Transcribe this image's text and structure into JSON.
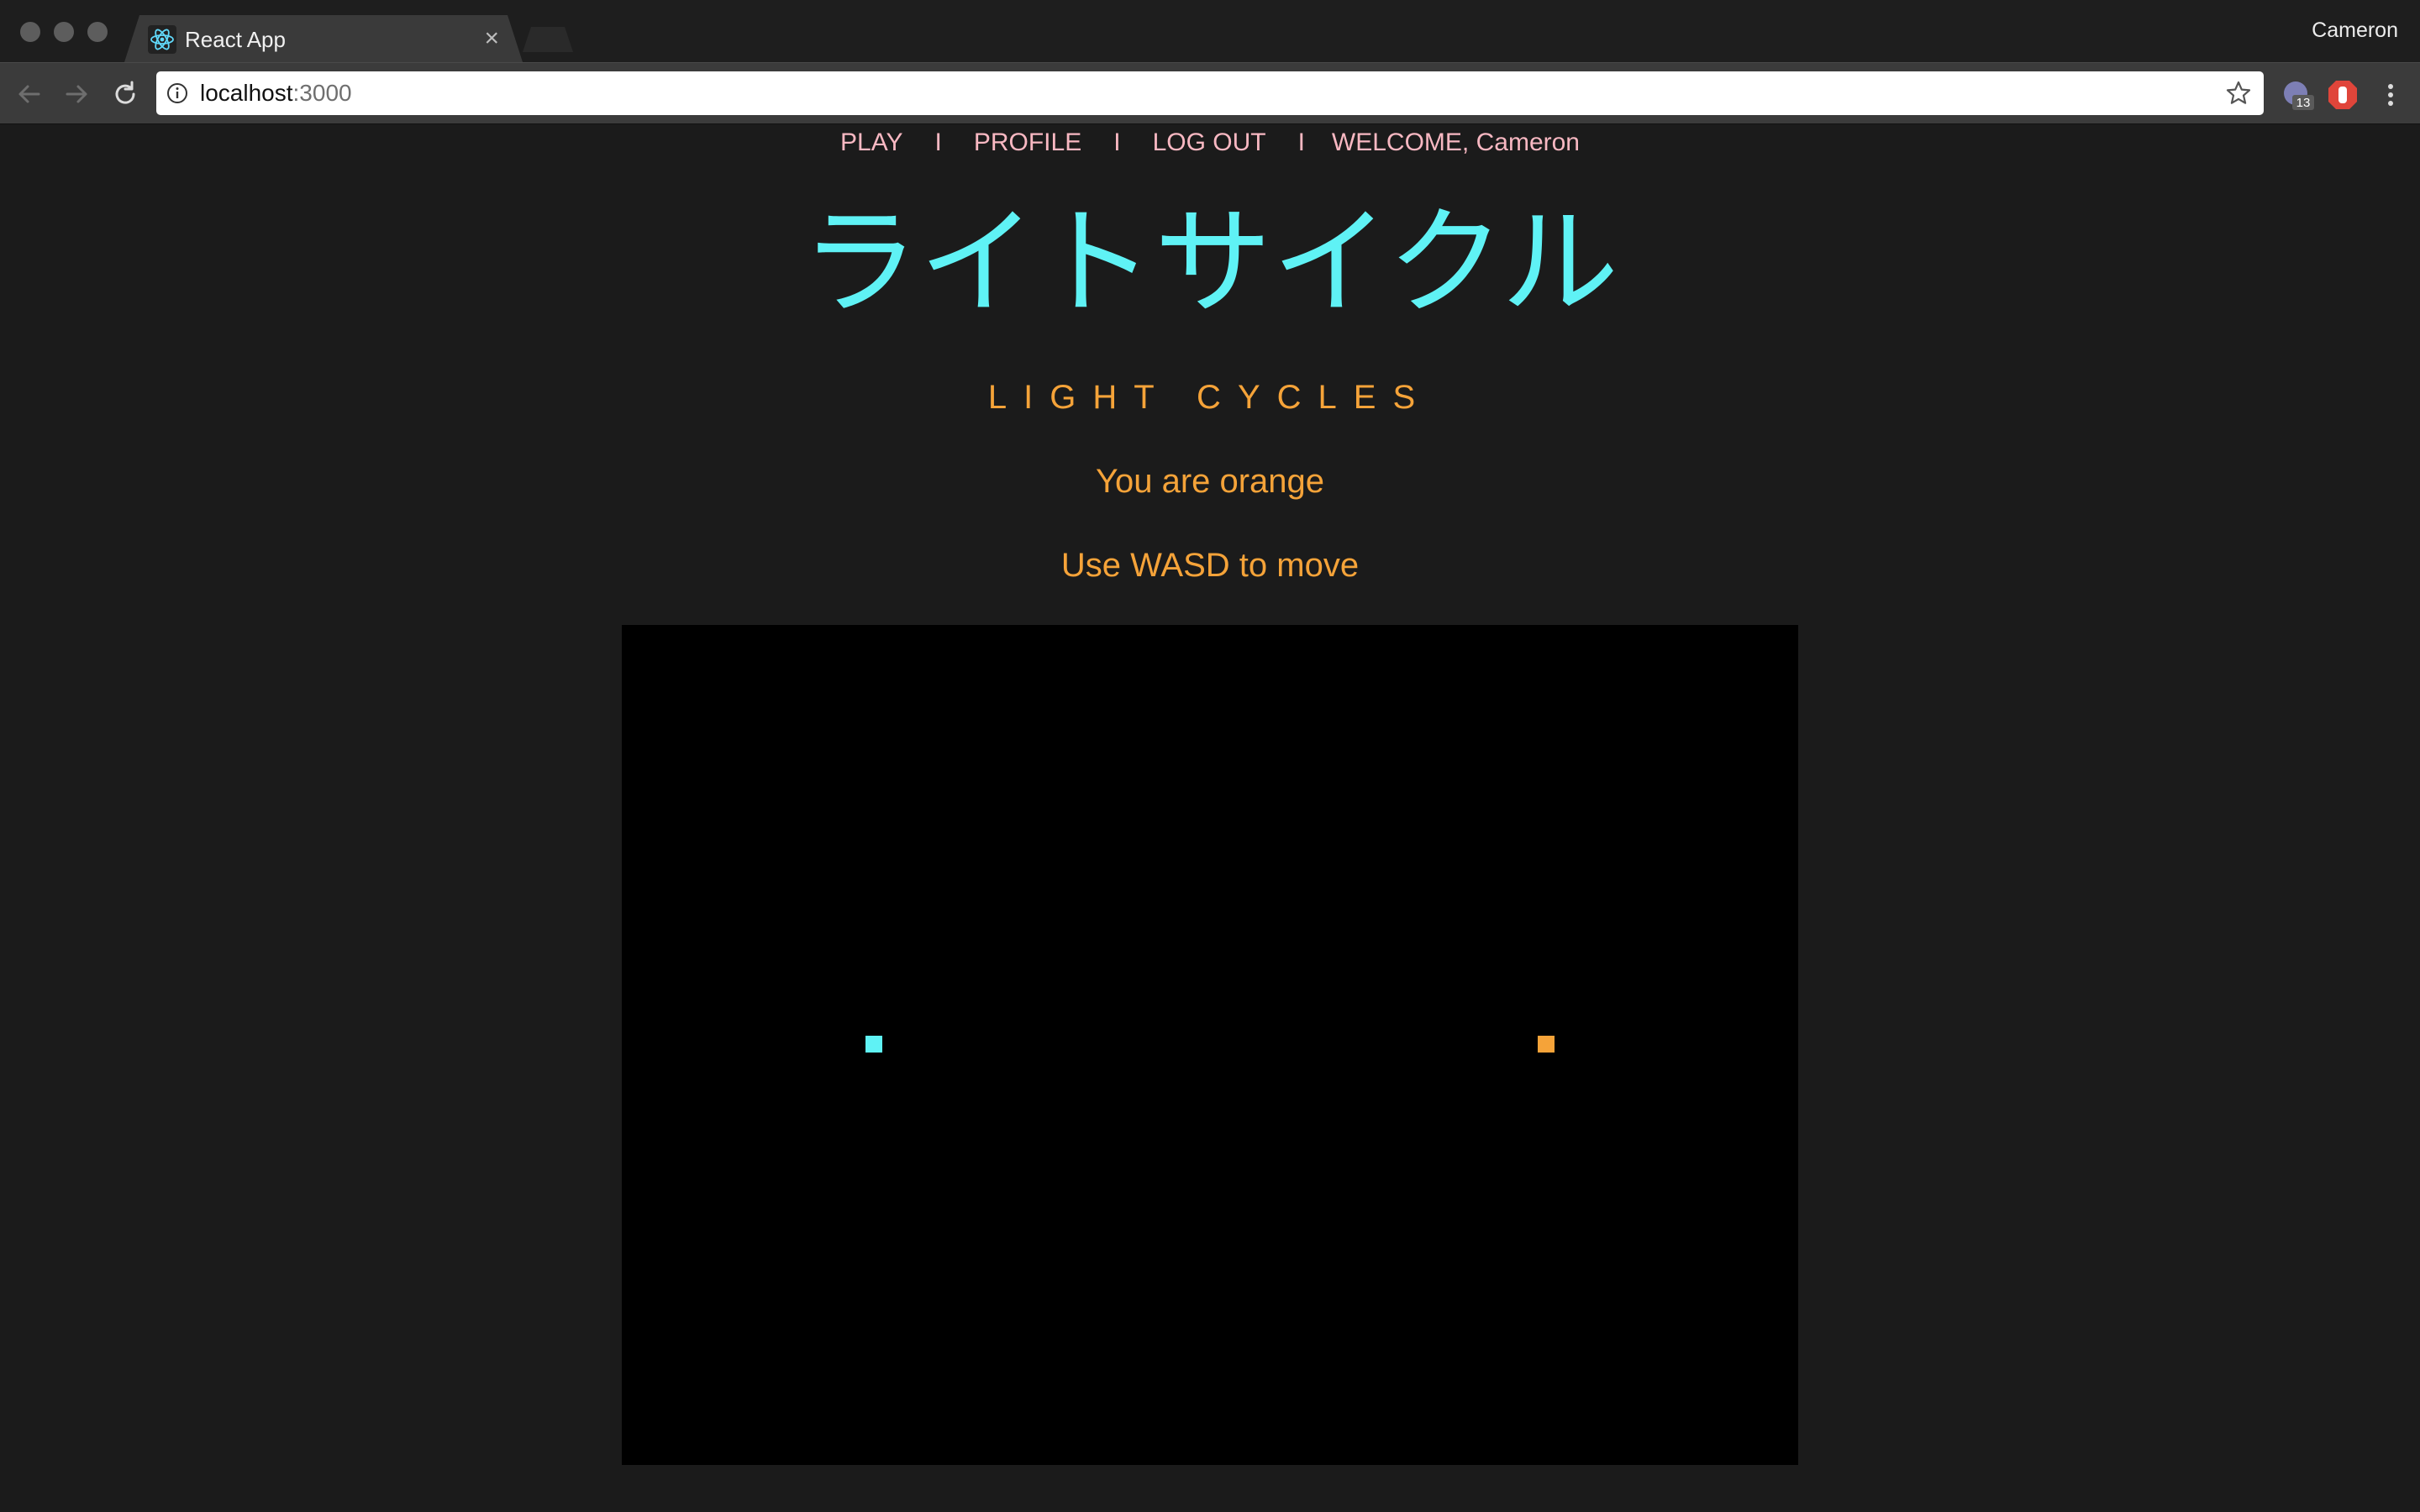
{
  "browser": {
    "tab_title": "React App",
    "tab_close": "×",
    "profile_name": "Cameron",
    "url_host": "localhost",
    "url_port": ":3000",
    "extension_badge": "13"
  },
  "nav": {
    "play": "PLAY",
    "separator": "I",
    "profile": "PROFILE",
    "logout": "LOG OUT",
    "welcome": "WELCOME, Cameron"
  },
  "header": {
    "title_jp": "ライトサイクル",
    "subtitle": "LIGHT CYCLES"
  },
  "info": {
    "color_text": "You are orange",
    "controls_text": "Use WASD to move"
  },
  "game": {
    "player_colors": {
      "cyan": "#5ff2f5",
      "orange": "#f5a339"
    }
  },
  "colors": {
    "nav_text": "#f8b8c2",
    "title": "#5ff2f5",
    "accent": "#f5a339",
    "background": "#1b1b1b",
    "canvas": "#000000"
  }
}
